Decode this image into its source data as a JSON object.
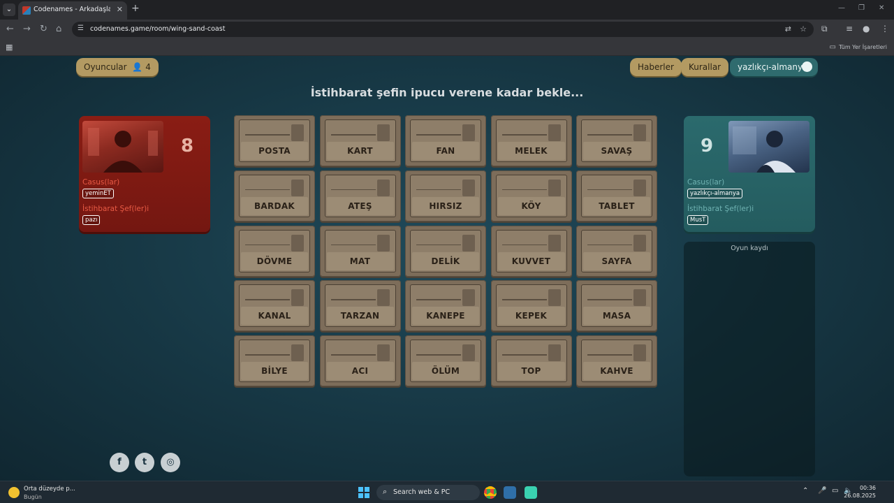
{
  "browser": {
    "tab_title": "Codenames - Arkadaşlarınızla ç",
    "url": "codenames.game/room/wing-sand-coast",
    "bookmarks_all": "Tüm Yer İşaretleri"
  },
  "header": {
    "players_label": "Oyuncular",
    "players_count": "4",
    "news_label": "Haberler",
    "rules_label": "Kurallar",
    "user_label": "yazlıkçı-almanya"
  },
  "status_text": "İstihbarat şefin ipucu verene kadar bekle...",
  "teams": {
    "red": {
      "score": "8",
      "spies_label": "Casus(lar)",
      "spies": "yeminET",
      "chief_label": "İstihbarat Şef(ler)i",
      "chief": "pazı",
      "color": "#8a1d14"
    },
    "blue": {
      "score": "9",
      "spies_label": "Casus(lar)",
      "spies": "yazlıkçı-almanya",
      "chief_label": "İstihbarat Şef(ler)i",
      "chief": "MusT",
      "color": "#2b6a6d"
    }
  },
  "board": {
    "cards": [
      "POSTA",
      "KART",
      "FAN",
      "MELEK",
      "SAVAŞ",
      "BARDAK",
      "ATEŞ",
      "HIRSIZ",
      "KÖY",
      "TABLET",
      "DÖVME",
      "MAT",
      "DELİK",
      "KUVVET",
      "SAYFA",
      "KANAL",
      "TARZAN",
      "KANEPE",
      "KEPEK",
      "MASA",
      "BİLYE",
      "ACI",
      "ÖLÜM",
      "TOP",
      "KAHVE"
    ]
  },
  "game_log_title": "Oyun kaydı",
  "social": [
    "facebook-icon",
    "twitter-icon",
    "instagram-icon"
  ],
  "taskbar": {
    "weather_title": "Orta düzeyde p...",
    "weather_sub": "Bugün",
    "search_placeholder": "Search web & PC",
    "time": "00:36",
    "date": "26.08.2025"
  }
}
